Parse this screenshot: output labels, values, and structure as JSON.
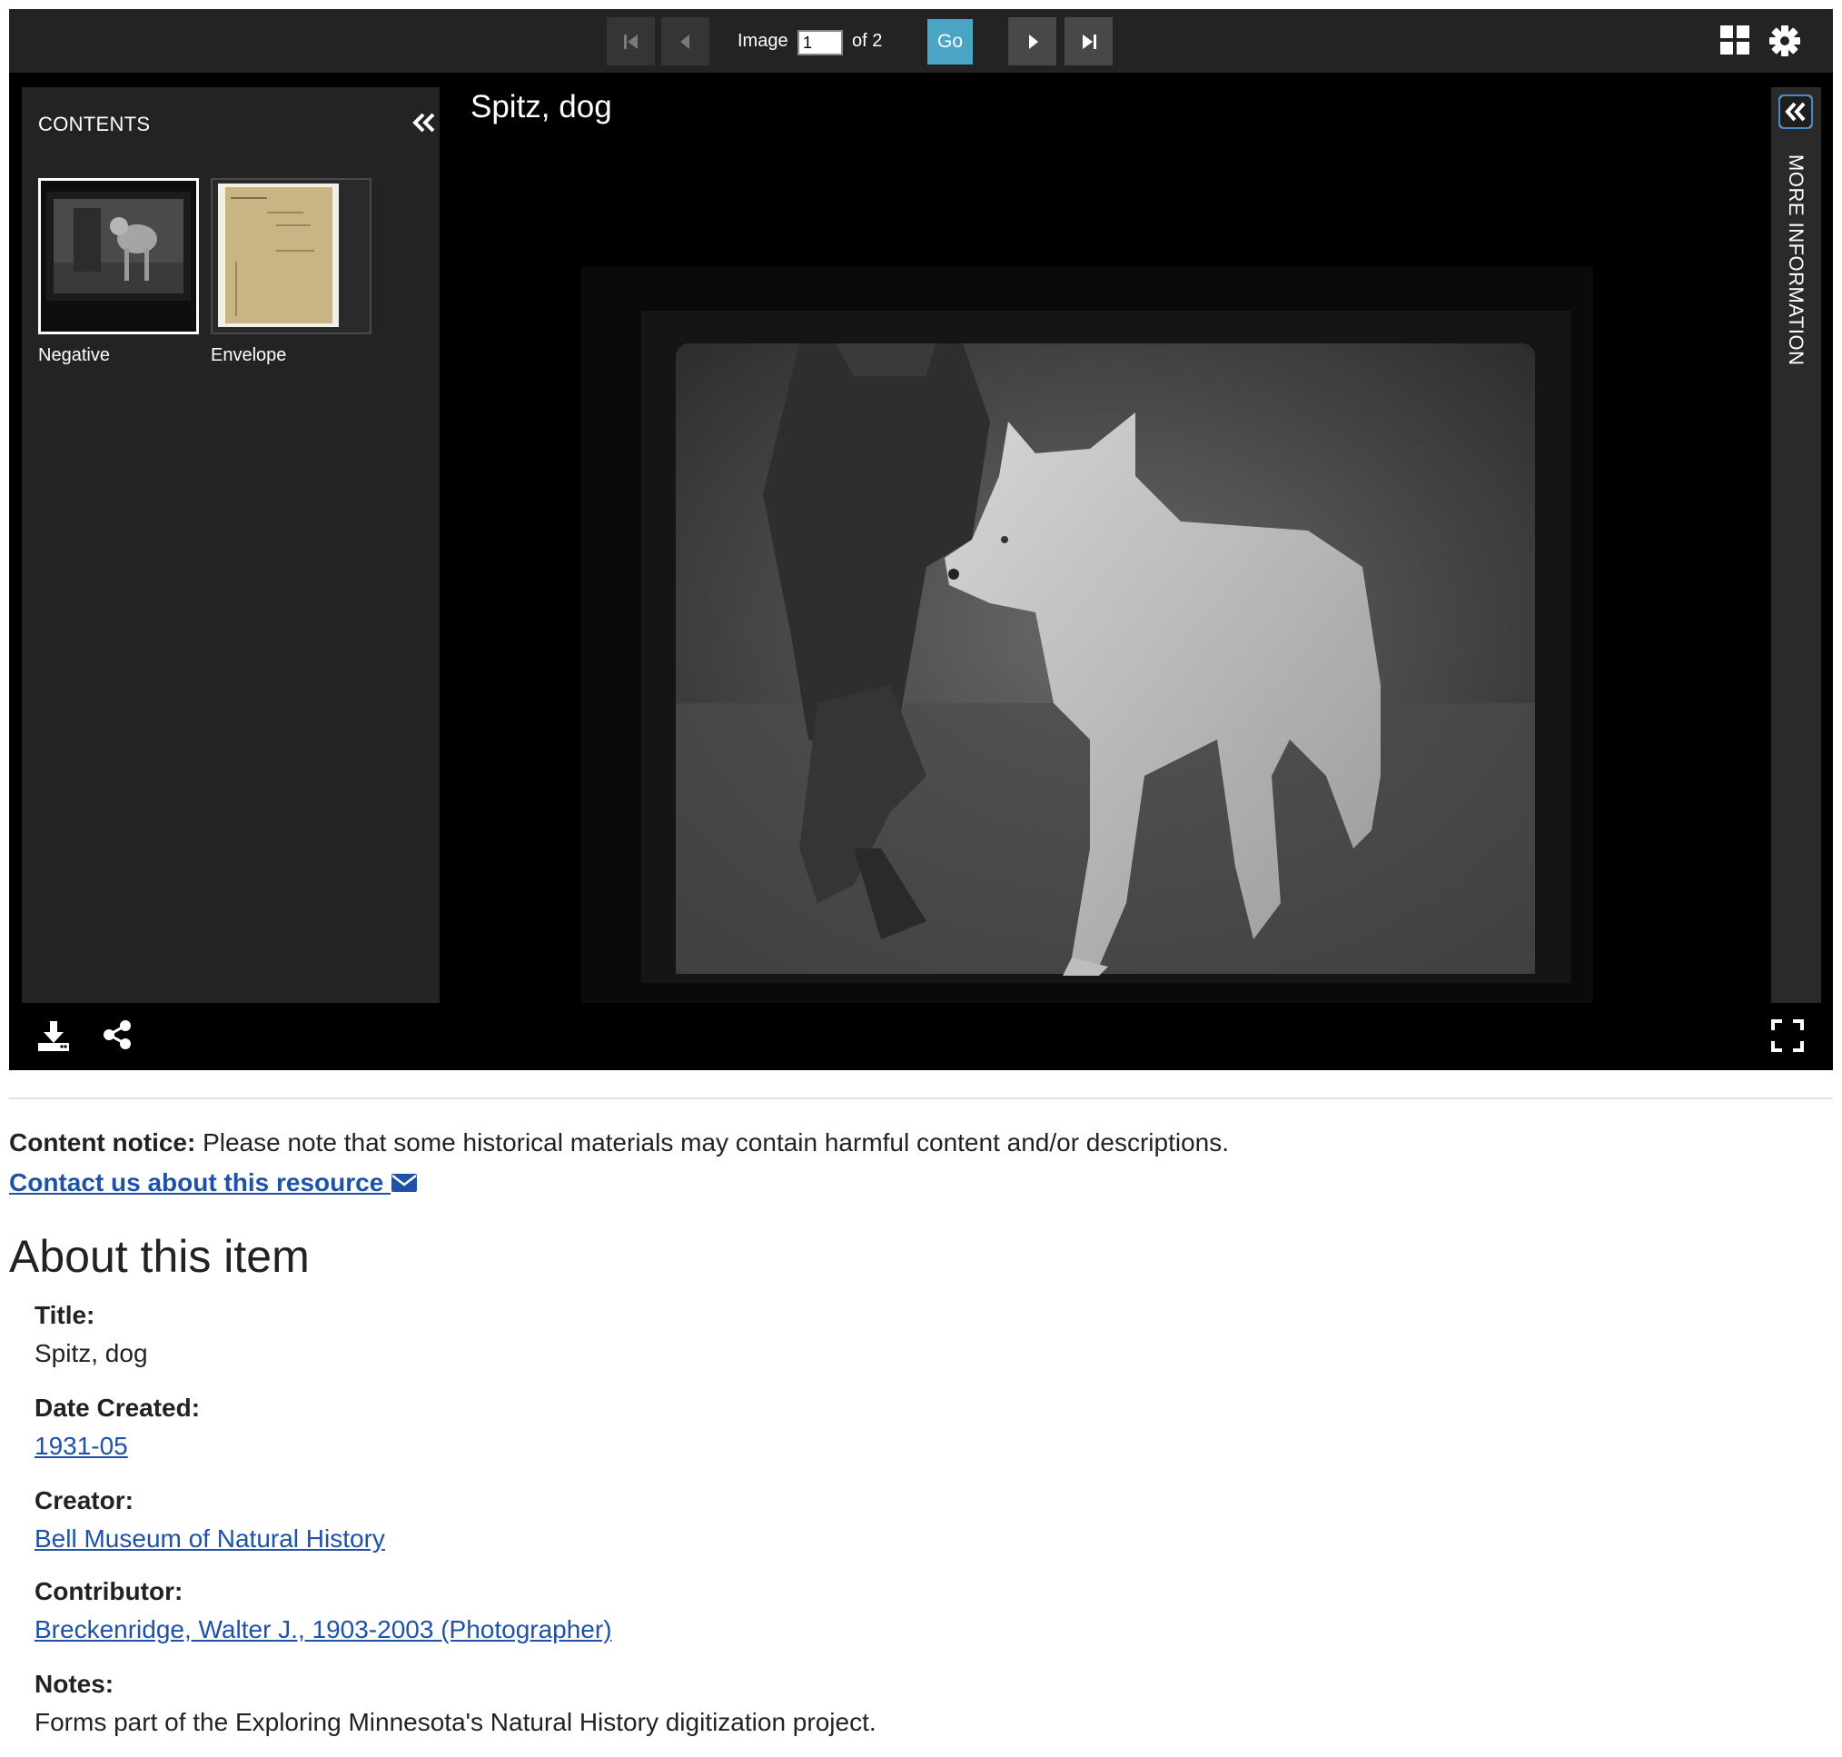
{
  "toolbar": {
    "image_label": "Image",
    "page_value": "1",
    "of_label": "of 2",
    "go_label": "Go"
  },
  "contents": {
    "title": "CONTENTS",
    "thumbnails": [
      {
        "label": "Negative"
      },
      {
        "label": "Envelope"
      }
    ]
  },
  "viewer": {
    "title": "Spitz, dog"
  },
  "more_info": {
    "label": "MORE INFORMATION"
  },
  "notice": {
    "label": "Content notice:",
    "text": " Please note that some historical materials may contain harmful content and/or descriptions."
  },
  "contact": {
    "text": "Contact us about this resource"
  },
  "about": {
    "heading": "About this item",
    "fields": [
      {
        "label": "Title:",
        "value": "Spitz, dog"
      },
      {
        "label": "Date Created:",
        "value": "1931-05"
      },
      {
        "label": "Creator:",
        "value": "Bell Museum of Natural History"
      },
      {
        "label": "Contributor:",
        "value": "Breckenridge, Walter J., 1903-2003 (Photographer)"
      },
      {
        "label": "Notes:",
        "value": "Forms part of the Exploring Minnesota's Natural History digitization project."
      }
    ]
  },
  "colors": {
    "toolbar_bg": "#232323",
    "go_button": "#49a5c4",
    "link": "#1d52a8"
  }
}
